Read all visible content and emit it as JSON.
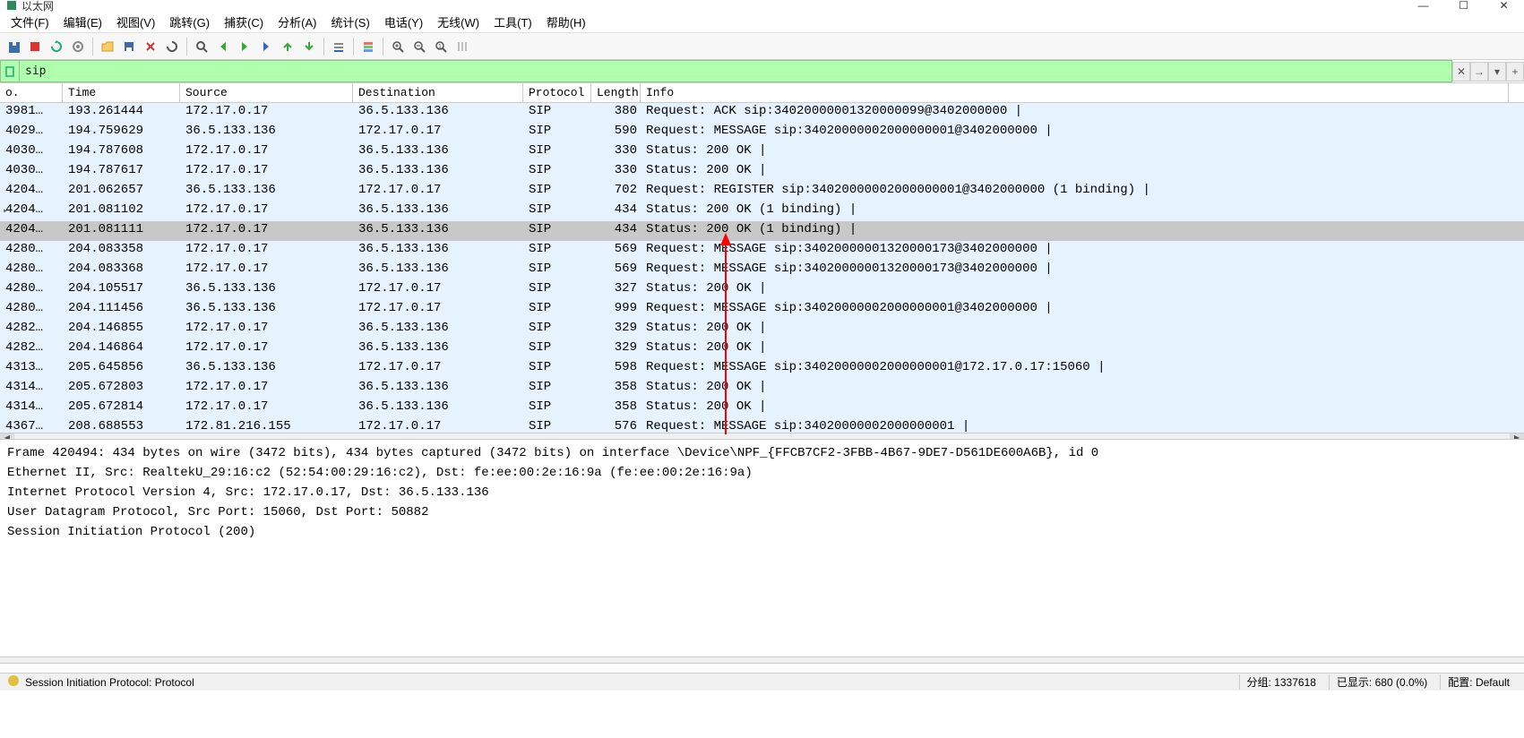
{
  "window": {
    "title": "以太网"
  },
  "menu": {
    "file": "文件(F)",
    "edit": "编辑(E)",
    "view": "视图(V)",
    "go": "跳转(G)",
    "capture": "捕获(C)",
    "analyze": "分析(A)",
    "statistics": "统计(S)",
    "telephony": "电话(Y)",
    "wireless": "无线(W)",
    "tools": "工具(T)",
    "help": "帮助(H)"
  },
  "filter": {
    "value": "sip",
    "placeholder": ""
  },
  "columns": {
    "no": "o.",
    "time": "Time",
    "source": "Source",
    "destination": "Destination",
    "protocol": "Protocol",
    "length": "Length",
    "info": "Info"
  },
  "packets": [
    {
      "no": "3981…",
      "time": "193.261444",
      "src": "172.17.0.17",
      "dst": "36.5.133.136",
      "proto": "SIP",
      "len": "380",
      "info": "Request: ACK sip:34020000001320000099@3402000000  | "
    },
    {
      "no": "4029…",
      "time": "194.759629",
      "src": "36.5.133.136",
      "dst": "172.17.0.17",
      "proto": "SIP",
      "len": "590",
      "info": "Request: MESSAGE sip:34020000002000000001@3402000000  | "
    },
    {
      "no": "4030…",
      "time": "194.787608",
      "src": "172.17.0.17",
      "dst": "36.5.133.136",
      "proto": "SIP",
      "len": "330",
      "info": "Status: 200 OK | "
    },
    {
      "no": "4030…",
      "time": "194.787617",
      "src": "172.17.0.17",
      "dst": "36.5.133.136",
      "proto": "SIP",
      "len": "330",
      "info": "Status: 200 OK | "
    },
    {
      "no": "4204…",
      "time": "201.062657",
      "src": "36.5.133.136",
      "dst": "172.17.0.17",
      "proto": "SIP",
      "len": "702",
      "info": "Request: REGISTER sip:34020000002000000001@3402000000  (1 binding) | "
    },
    {
      "no": "4204…",
      "time": "201.081102",
      "src": "172.17.0.17",
      "dst": "36.5.133.136",
      "proto": "SIP",
      "len": "434",
      "info": "Status: 200 OK  (1 binding) | ",
      "marker": true
    },
    {
      "no": "4204…",
      "time": "201.081111",
      "src": "172.17.0.17",
      "dst": "36.5.133.136",
      "proto": "SIP",
      "len": "434",
      "info": "Status: 200 OK  (1 binding) | ",
      "selected": true
    },
    {
      "no": "4280…",
      "time": "204.083358",
      "src": "172.17.0.17",
      "dst": "36.5.133.136",
      "proto": "SIP",
      "len": "569",
      "info": "Request: MESSAGE sip:34020000001320000173@3402000000  | "
    },
    {
      "no": "4280…",
      "time": "204.083368",
      "src": "172.17.0.17",
      "dst": "36.5.133.136",
      "proto": "SIP",
      "len": "569",
      "info": "Request: MESSAGE sip:34020000001320000173@3402000000  | "
    },
    {
      "no": "4280…",
      "time": "204.105517",
      "src": "36.5.133.136",
      "dst": "172.17.0.17",
      "proto": "SIP",
      "len": "327",
      "info": "Status: 200 OK | "
    },
    {
      "no": "4280…",
      "time": "204.111456",
      "src": "36.5.133.136",
      "dst": "172.17.0.17",
      "proto": "SIP",
      "len": "999",
      "info": "Request: MESSAGE sip:34020000002000000001@3402000000  | "
    },
    {
      "no": "4282…",
      "time": "204.146855",
      "src": "172.17.0.17",
      "dst": "36.5.133.136",
      "proto": "SIP",
      "len": "329",
      "info": "Status: 200 OK | "
    },
    {
      "no": "4282…",
      "time": "204.146864",
      "src": "172.17.0.17",
      "dst": "36.5.133.136",
      "proto": "SIP",
      "len": "329",
      "info": "Status: 200 OK | "
    },
    {
      "no": "4313…",
      "time": "205.645856",
      "src": "36.5.133.136",
      "dst": "172.17.0.17",
      "proto": "SIP",
      "len": "598",
      "info": "Request: MESSAGE sip:34020000002000000001@172.17.0.17:15060  | "
    },
    {
      "no": "4314…",
      "time": "205.672803",
      "src": "172.17.0.17",
      "dst": "36.5.133.136",
      "proto": "SIP",
      "len": "358",
      "info": "Status: 200 OK | "
    },
    {
      "no": "4314…",
      "time": "205.672814",
      "src": "172.17.0.17",
      "dst": "36.5.133.136",
      "proto": "SIP",
      "len": "358",
      "info": "Status: 200 OK | "
    },
    {
      "no": "4367…",
      "time": "208.688553",
      "src": "172.81.216.155",
      "dst": "172.17.0.17",
      "proto": "SIP",
      "len": "576",
      "info": "Request: MESSAGE sip:34020000002000000001  | "
    }
  ],
  "detail": [
    "Frame 420494: 434 bytes on wire (3472 bits), 434 bytes captured (3472 bits) on interface \\Device\\NPF_{FFCB7CF2-3FBB-4B67-9DE7-D561DE600A6B}, id 0",
    "Ethernet II, Src: RealtekU_29:16:c2 (52:54:00:29:16:c2), Dst: fe:ee:00:2e:16:9a (fe:ee:00:2e:16:9a)",
    "Internet Protocol Version 4, Src: 172.17.0.17, Dst: 36.5.133.136",
    "User Datagram Protocol, Src Port: 15060, Dst Port: 50882",
    "Session Initiation Protocol (200)"
  ],
  "status": {
    "left": "Session Initiation Protocol: Protocol",
    "mid": "分组: 1337618",
    "right": "已显示: 680 (0.0%)",
    "profile": "配置: Default"
  },
  "filter_buttons": {
    "clear": "✕",
    "arrow": "▾",
    "plus": "+"
  }
}
